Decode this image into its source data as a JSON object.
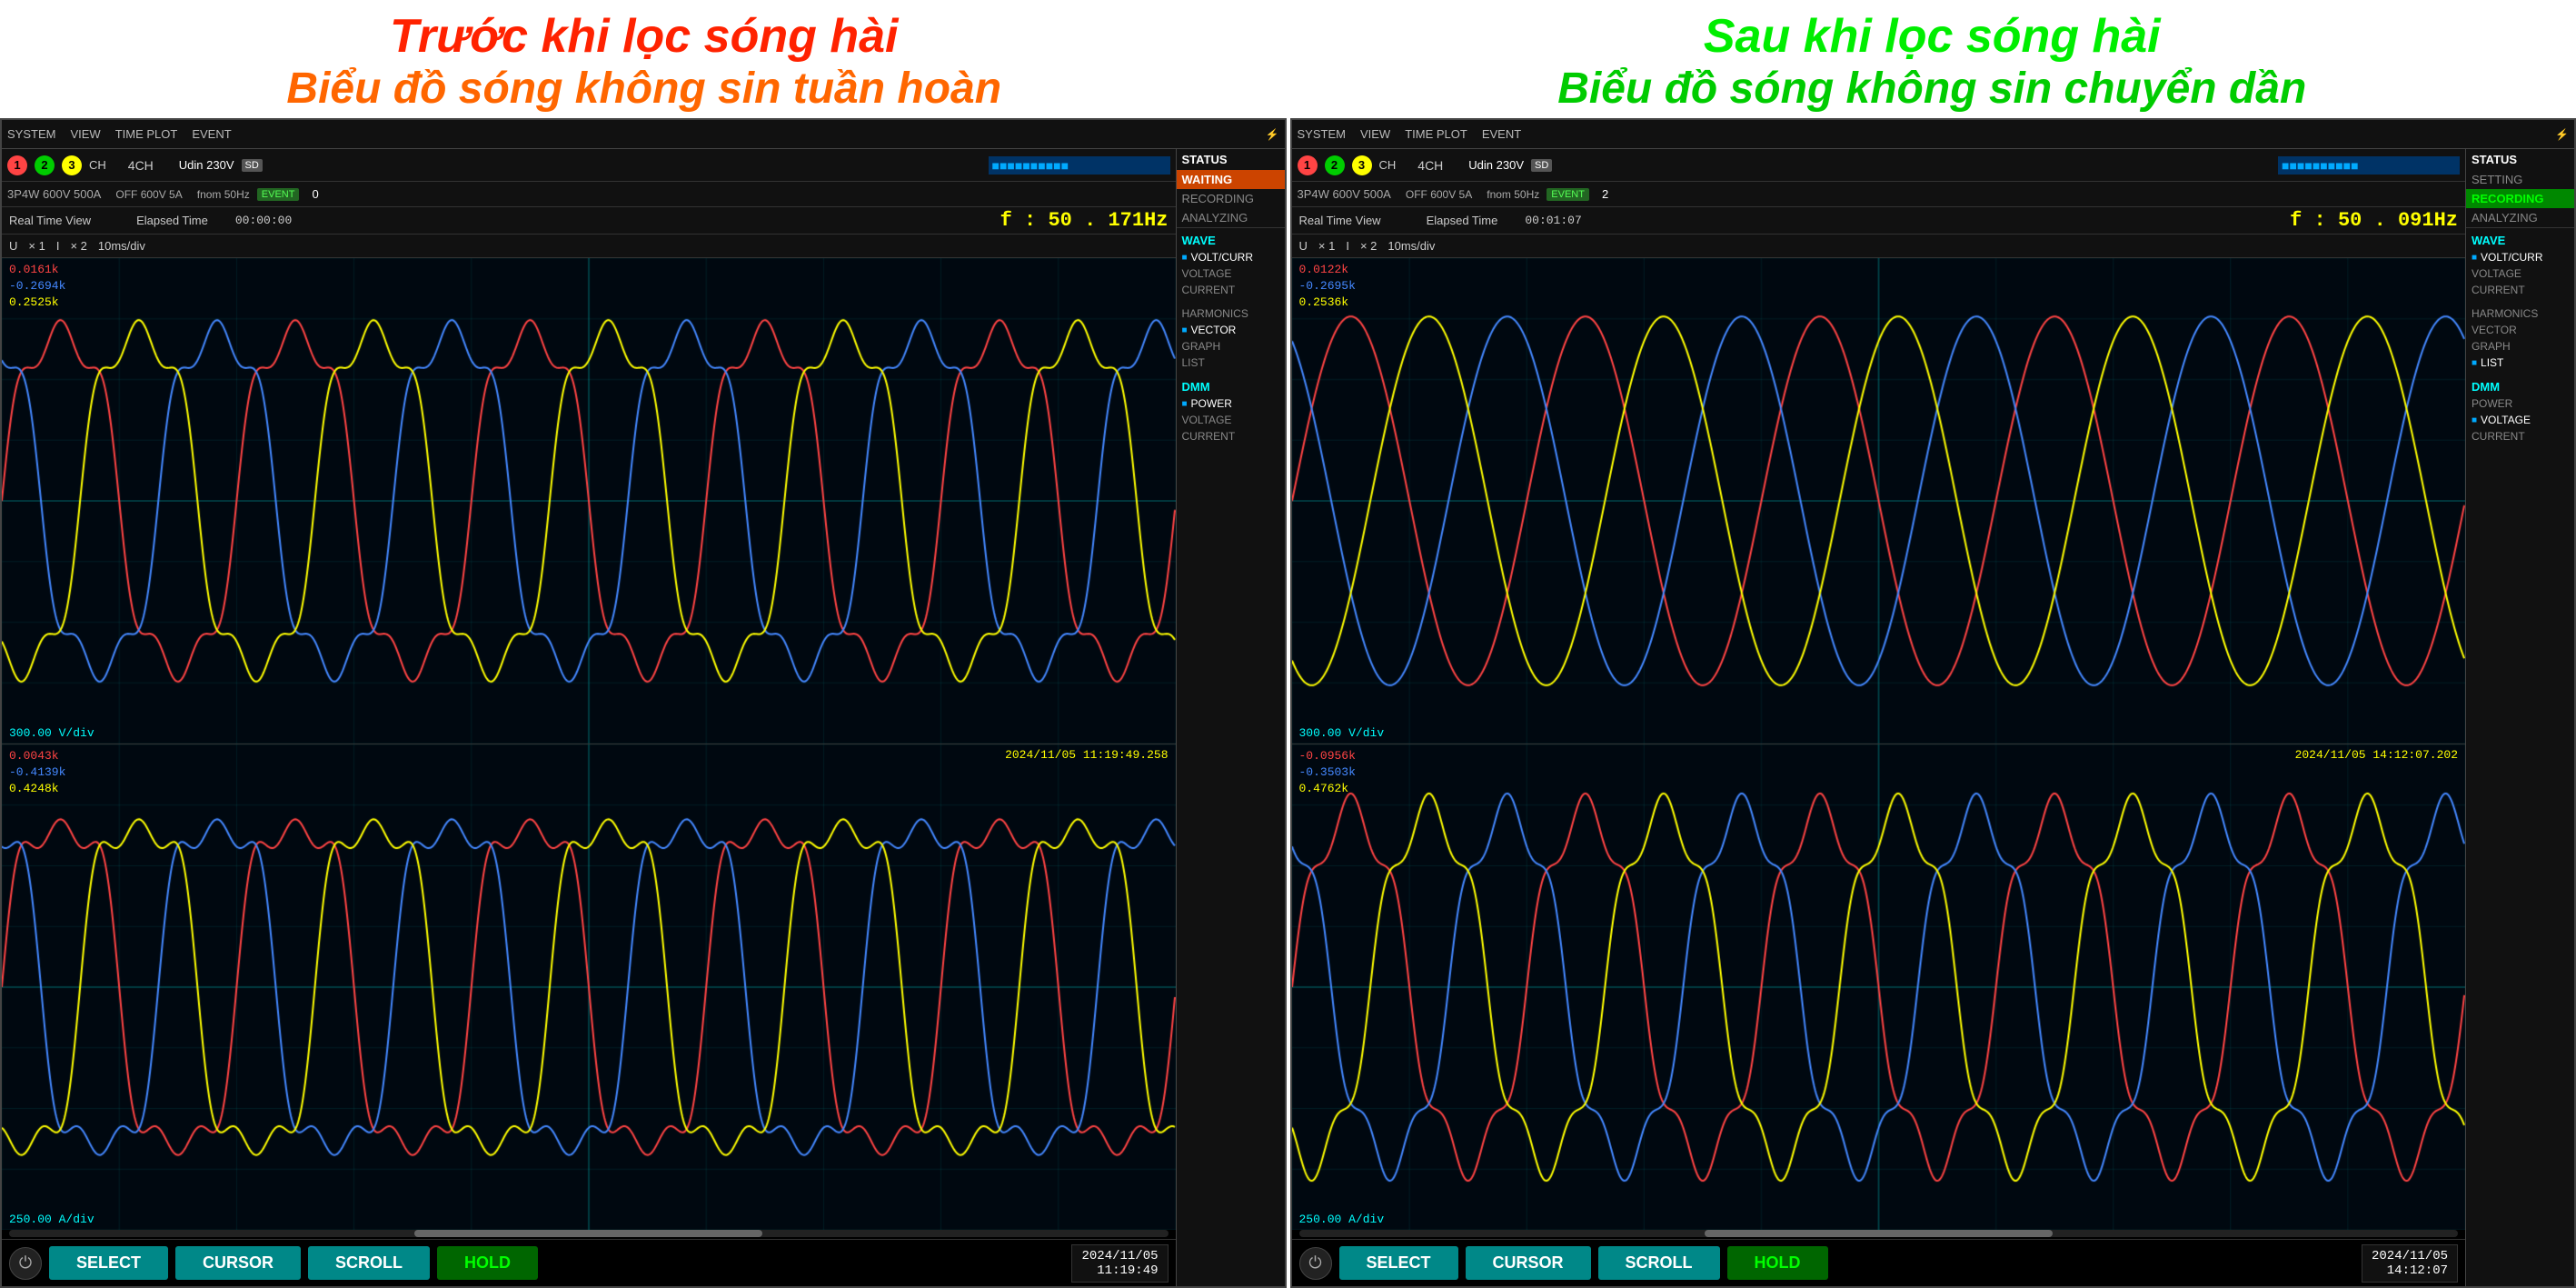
{
  "left_title": {
    "main": "Trước khi lọc sóng hài",
    "sub": "Biểu đồ sóng không sin tuần hoàn",
    "color_main": "#ff2200",
    "color_sub": "#ff6600"
  },
  "right_title": {
    "main": "Sau khi lọc sóng hài",
    "sub": "Biểu đồ sóng không sin chuyển dần",
    "color_main": "#00ee00",
    "color_sub": "#00cc00"
  },
  "left_panel": {
    "menu": [
      "SYSTEM",
      "VIEW",
      "TIME PLOT",
      "EVENT"
    ],
    "channels": "123CH",
    "ch4": "4CH",
    "udin": "Udin 230V",
    "config": "3P4W  600V  500A",
    "off": "OFF 600V   5A",
    "fnom": "fnom  50Hz",
    "event_num": "0",
    "status_bar": {
      "status": "STATUS",
      "waiting": "WAITING",
      "recording": "RECORDING",
      "analyzing": "ANALYZING"
    },
    "realtime": "Real Time View",
    "elapsed": "Elapsed Time",
    "elapsed_val": "00:00:00",
    "freq": "f : 50 . 171Hz",
    "scale_u": "U",
    "scale_x1": "× 1",
    "scale_i": "I",
    "scale_x2": "× 2",
    "scale_time": "10ms/div",
    "upper_labels": {
      "v1": "0.0161k",
      "v2": "-0.2694k",
      "v3": "0.2525k"
    },
    "lower_labels": {
      "v1": "0.0043k",
      "v2": "-0.4139k",
      "v3": "0.4248k",
      "timestamp": "2024/11/05  11:19:49.258"
    },
    "upper_vdiv": "300.00 V/div",
    "lower_adiv": "250.00 A/div",
    "wave_menu": {
      "wave": "WAVE",
      "volt_curr": "VOLT/CURR",
      "voltage": "VOLTAGE",
      "current": "CURRENT",
      "harmonics": "HARMONICS",
      "vector": "VECTOR",
      "graph": "GRAPH",
      "list": "LIST",
      "dmm": "DMM",
      "power": "POWER",
      "voltage2": "VOLTAGE",
      "current2": "CURRENT"
    },
    "buttons": {
      "select": "SELECT",
      "cursor": "CURSOR",
      "scroll": "SCROLL",
      "hold": "HOLD"
    },
    "timestamp_bottom": {
      "date": "2024/11/05",
      "time": "11:19:49"
    }
  },
  "right_panel": {
    "menu": [
      "SYSTEM",
      "VIEW",
      "TIME PLOT",
      "EVENT"
    ],
    "channels": "123CH",
    "ch4": "4CH",
    "udin": "Udin 230V",
    "config": "3P4W  600V  500A",
    "off": "OFF 600V   5A",
    "fnom": "fnom  50Hz",
    "event_num": "2",
    "status_bar": {
      "status": "STATUS",
      "setting": "SETTING",
      "recording": "RECORDING",
      "analyzing": "ANALYZING"
    },
    "realtime": "Real Time View",
    "elapsed": "Elapsed Time",
    "elapsed_val": "00:01:07",
    "freq": "f : 50 . 091Hz",
    "scale_u": "U",
    "scale_x1": "× 1",
    "scale_i": "I",
    "scale_x2": "× 2",
    "scale_time": "10ms/div",
    "upper_labels": {
      "v1": "0.0122k",
      "v2": "-0.2695k",
      "v3": "0.2536k"
    },
    "lower_labels": {
      "v1": "-0.0956k",
      "v2": "-0.3503k",
      "v3": "0.4762k",
      "timestamp": "2024/11/05  14:12:07.202"
    },
    "upper_vdiv": "300.00 V/div",
    "lower_adiv": "250.00 A/div",
    "wave_menu": {
      "wave": "WAVE",
      "volt_curr": "VOLT/CURR",
      "voltage": "VOLTAGE",
      "current": "CURRENT",
      "harmonics": "HARMONICS",
      "vector": "VECTOR",
      "graph": "GRAPH",
      "list": "LIST",
      "dmm": "DMM",
      "power": "POWER",
      "voltage2": "VOLTAGE",
      "current2": "CURRENT"
    },
    "buttons": {
      "select": "SELECT",
      "cursor": "CURSOR",
      "scroll": "SCROLL",
      "hold": "HOLD"
    },
    "timestamp_bottom": {
      "date": "2024/11/05",
      "time": "14:12:07"
    }
  }
}
